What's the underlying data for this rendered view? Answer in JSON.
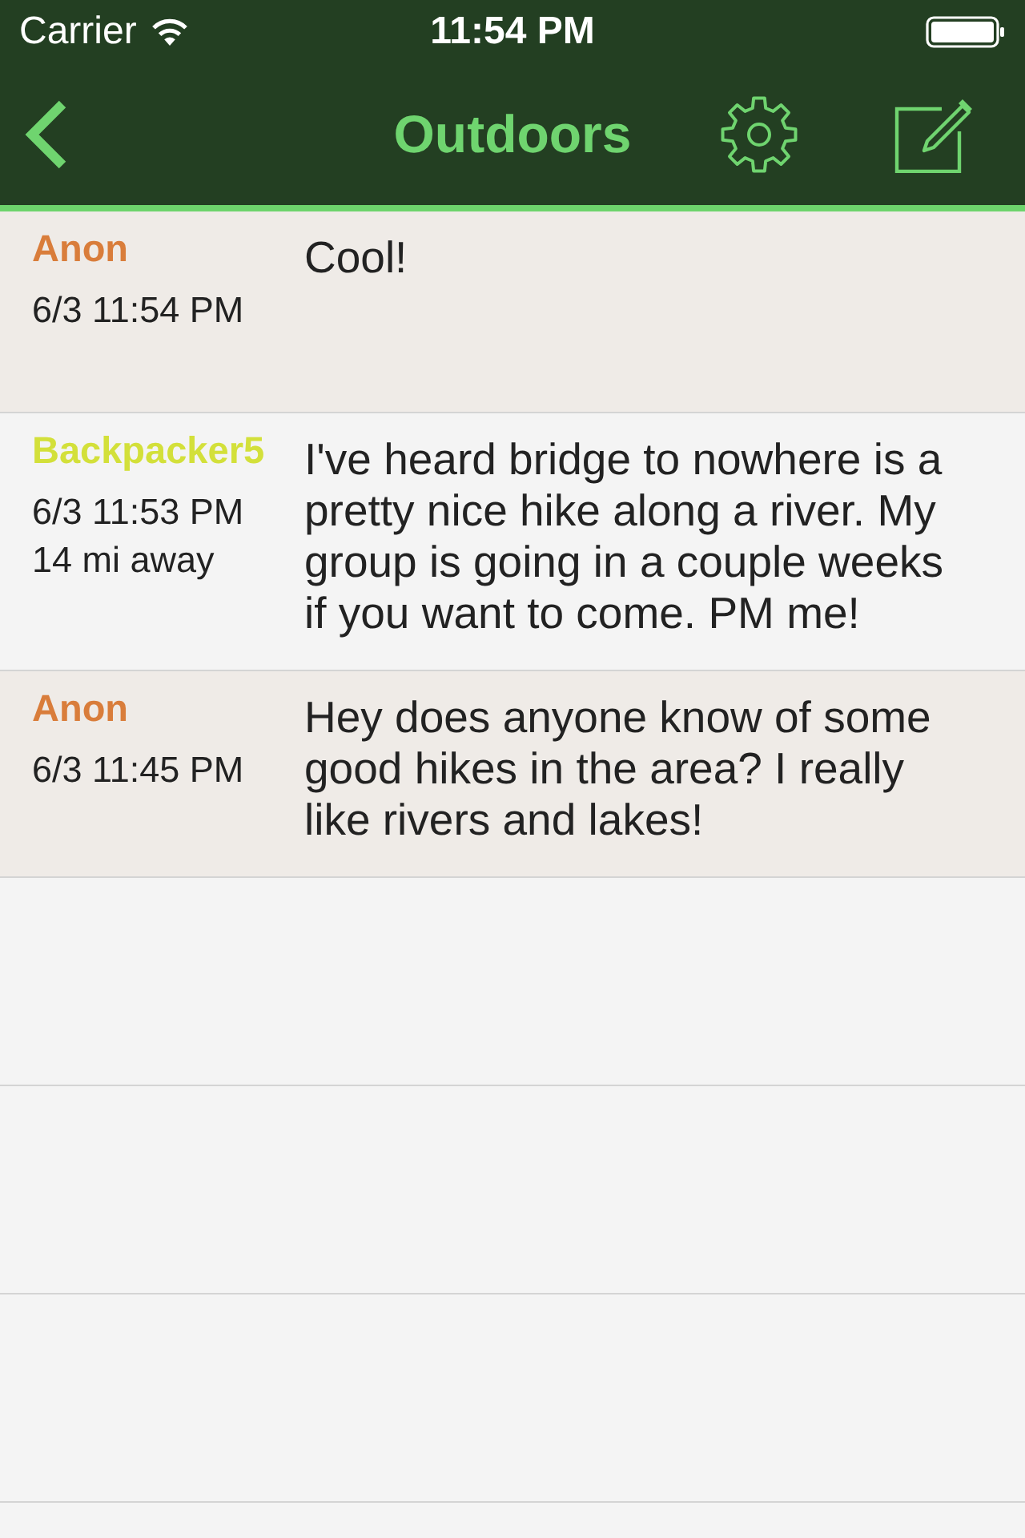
{
  "status_bar": {
    "carrier": "Carrier",
    "time": "11:54 PM"
  },
  "nav_bar": {
    "title": "Outdoors"
  },
  "posts": [
    {
      "author": "Anon",
      "color": "#d97d3b",
      "timestamp": "6/3 11:54 PM",
      "message": "Cool!",
      "highlighted": true
    },
    {
      "author": "Backpacker5",
      "color": "#d3e03a",
      "timestamp": "6/3 11:53 PM",
      "distance": "14 mi away",
      "message": "I've heard bridge to nowhere is a pretty nice hike along a river. My group is going in a couple weeks if you want to come. PM me!",
      "highlighted": false
    },
    {
      "author": "Anon",
      "color": "#d97d3b",
      "timestamp": "6/3 11:45 PM",
      "message": "Hey does anyone know of some good hikes in the area? I really like rivers and lakes!",
      "highlighted": true
    }
  ]
}
